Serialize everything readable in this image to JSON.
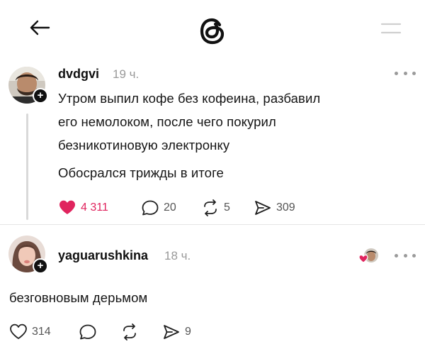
{
  "header": {
    "back_icon": "arrow-left-icon",
    "logo_icon": "threads-logo",
    "menu_icon": "menu-icon"
  },
  "post": {
    "username": "dvdgvi",
    "time": "19 ч.",
    "text_lines": [
      "Утром выпил кофе без кофеина, разбавил",
      "его немолоком, после чего покурил",
      "безникотиновую электронку"
    ],
    "text_second_paragraph": "Обосрался трижды в итоге",
    "likes": "4 311",
    "comments": "20",
    "reposts": "5",
    "shares": "309",
    "liked": true,
    "like_color": "#e0245e"
  },
  "reply": {
    "username": "yaguarushkina",
    "time": "18 ч.",
    "text": "безговновым дерьмом",
    "likes": "314",
    "shares": "9"
  }
}
